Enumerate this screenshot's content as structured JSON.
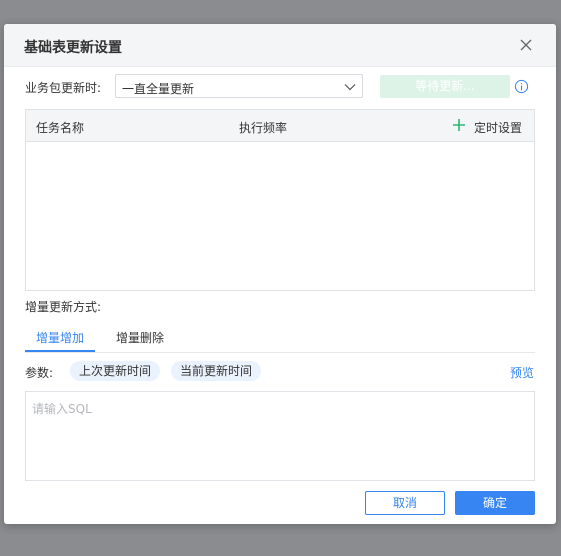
{
  "dialog": {
    "title": "基础表更新设置",
    "close_icon": "close-icon"
  },
  "update": {
    "label": "业务包更新时:",
    "select_value": "一直全量更新",
    "waiting_button": "等待更新...",
    "info_icon": "info-icon"
  },
  "table": {
    "columns": [
      "任务名称",
      "执行频率",
      "定时设置"
    ],
    "add_icon": "plus-icon",
    "rows": []
  },
  "incremental": {
    "label": "增量更新方式:",
    "tabs": [
      {
        "label": "增量增加",
        "active": true
      },
      {
        "label": "增量删除",
        "active": false
      }
    ]
  },
  "params": {
    "label": "参数:",
    "chips": [
      "上次更新时间",
      "当前更新时间"
    ],
    "preview": "预览"
  },
  "sql": {
    "placeholder": "请输入SQL",
    "value": ""
  },
  "footer": {
    "cancel": "取消",
    "ok": "确定"
  },
  "colors": {
    "accent": "#3685f2",
    "plus_green": "#2bb673",
    "disabled_green": "#def3e8"
  }
}
